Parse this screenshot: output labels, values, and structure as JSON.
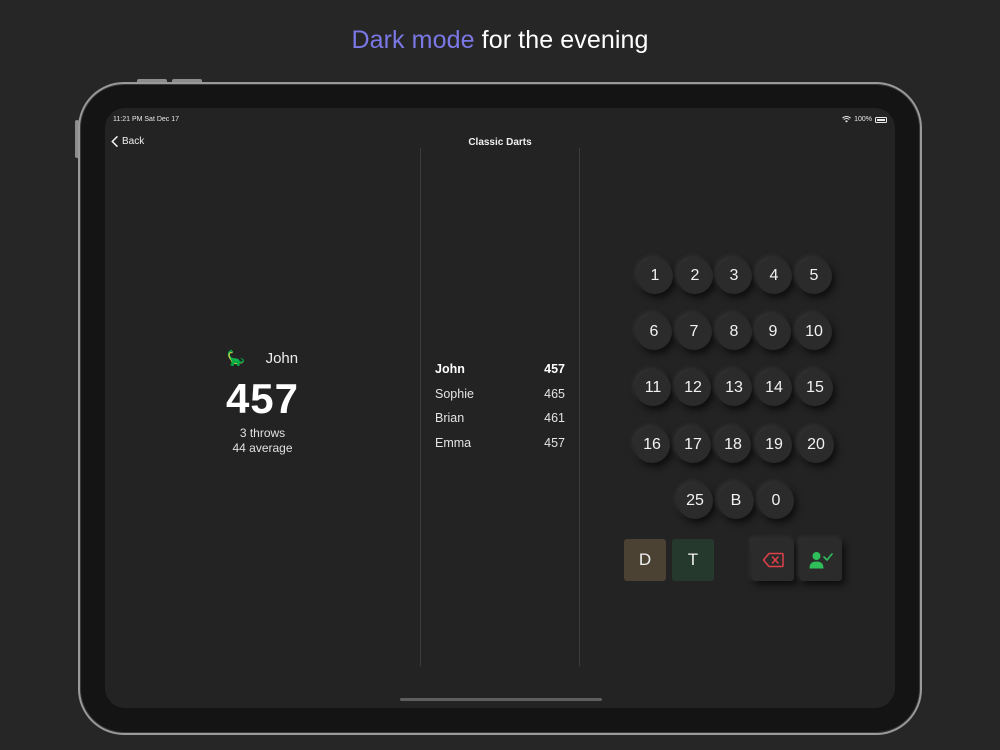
{
  "headline": {
    "accent": "Dark mode",
    "rest": " for the evening"
  },
  "status": {
    "time": "11:21 PM   Sat Dec 17",
    "battery": "100%"
  },
  "nav": {
    "back": "Back",
    "title": "Classic Darts"
  },
  "current": {
    "avatar": "🦕",
    "name": "John",
    "score": "457",
    "throws": "3 throws",
    "average": "44 average"
  },
  "players": [
    {
      "name": "John",
      "score": "457",
      "active": true
    },
    {
      "name": "Sophie",
      "score": "465"
    },
    {
      "name": "Brian",
      "score": "461"
    },
    {
      "name": "Emma",
      "score": "457"
    }
  ],
  "keypad": {
    "rows": [
      [
        "1",
        "2",
        "3",
        "4",
        "5"
      ],
      [
        "6",
        "7",
        "8",
        "9",
        "10"
      ],
      [
        "11",
        "12",
        "13",
        "14",
        "15"
      ],
      [
        "16",
        "17",
        "18",
        "19",
        "20"
      ],
      [
        "25",
        "B",
        "0"
      ]
    ],
    "double": "D",
    "triple": "T"
  },
  "colors": {
    "accent": "#7b78e6",
    "delete": "#e0404a",
    "confirm": "#2fbf5a",
    "double_bg": "#4b4234",
    "triple_bg": "#26392d"
  },
  "icons": {
    "back": "chevron-left-icon",
    "wifi": "wifi-icon",
    "battery": "battery-icon",
    "delete": "backspace-icon",
    "confirm": "user-check-icon"
  }
}
